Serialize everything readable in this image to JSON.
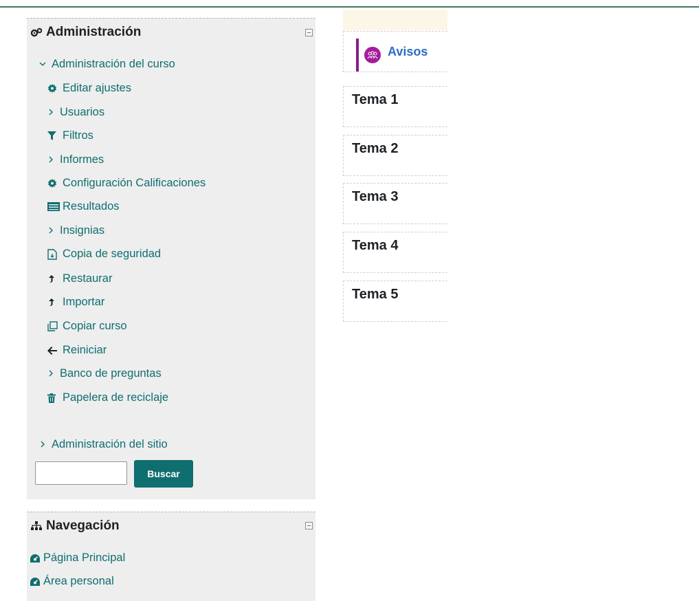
{
  "administration": {
    "title": "Administración",
    "course_admin_label": "Administración del curso",
    "items": [
      {
        "label": "Editar ajustes",
        "icon": "gear-icon"
      },
      {
        "label": "Usuarios",
        "icon": "chevron-right-icon"
      },
      {
        "label": "Filtros",
        "icon": "filter-icon"
      },
      {
        "label": "Informes",
        "icon": "chevron-right-icon"
      },
      {
        "label": "Configuración Calificaciones",
        "icon": "gear-icon"
      },
      {
        "label": "Resultados",
        "icon": "table-icon"
      },
      {
        "label": "Insignias",
        "icon": "chevron-right-icon"
      },
      {
        "label": "Copia de seguridad",
        "icon": "file-backup-icon"
      },
      {
        "label": "Restaurar",
        "icon": "upload-arrow-icon"
      },
      {
        "label": "Importar",
        "icon": "upload-arrow-icon"
      },
      {
        "label": "Copiar curso",
        "icon": "copy-icon"
      },
      {
        "label": "Reiniciar",
        "icon": "arrow-left-icon"
      },
      {
        "label": "Banco de preguntas",
        "icon": "chevron-right-icon"
      },
      {
        "label": "Papelera de reciclaje",
        "icon": "trash-icon"
      }
    ],
    "site_admin_label": "Administración del sitio",
    "search": {
      "value": "",
      "button_label": "Buscar"
    }
  },
  "navigation": {
    "title": "Navegación",
    "items": [
      {
        "label": "Página Principal",
        "icon": "dashboard-icon"
      },
      {
        "label": "Área personal",
        "icon": "dashboard-icon"
      }
    ]
  },
  "course": {
    "forum_label": "Avisos",
    "sections": [
      "Tema 1",
      "Tema 2",
      "Tema 3",
      "Tema 4",
      "Tema 5"
    ]
  },
  "colors": {
    "accent": "#0f6e70",
    "forum_purple": "#a51c9a",
    "link_blue": "#2b6fc2"
  }
}
